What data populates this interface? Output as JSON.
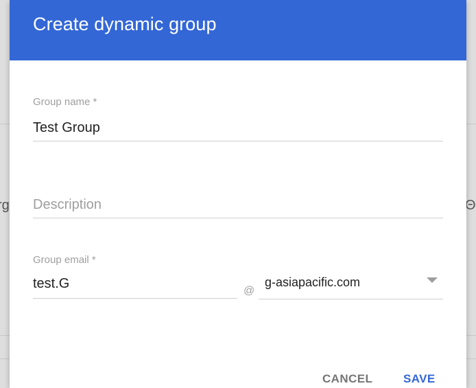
{
  "dialog": {
    "title": "Create dynamic group",
    "header_color": "#3367d6",
    "group_name": {
      "label": "Group name *",
      "value": "Test Group"
    },
    "description": {
      "placeholder": "Description",
      "value": ""
    },
    "group_email": {
      "label": "Group email *",
      "value": "test.G",
      "at_symbol": "@",
      "domain": "g-asiapacific.com"
    },
    "buttons": {
      "cancel": "CANCEL",
      "save": "SAVE"
    }
  },
  "background": {
    "left_fragment": "rg",
    "right_fragment": "Θn"
  }
}
